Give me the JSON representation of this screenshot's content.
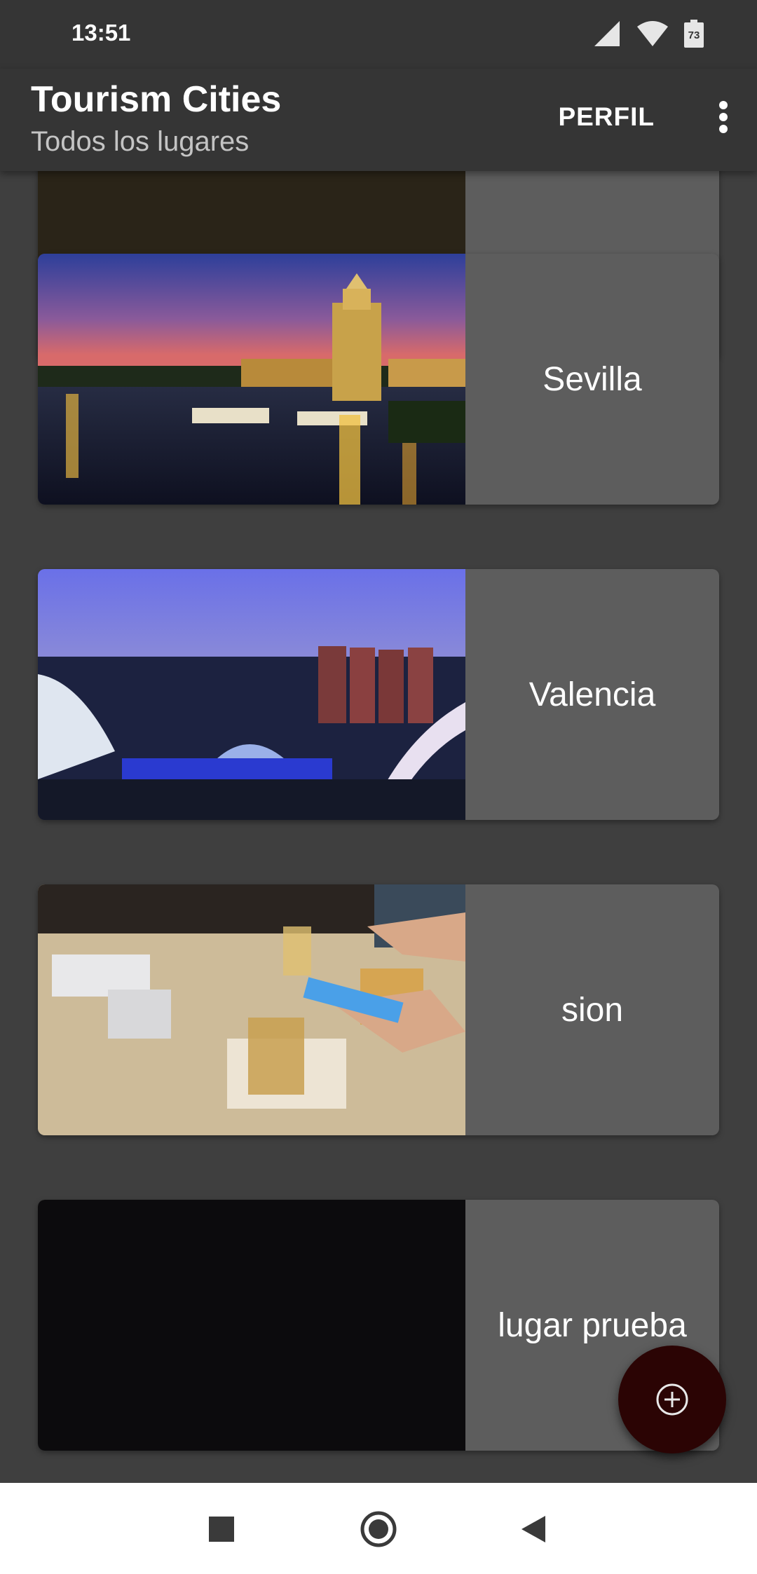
{
  "status_bar": {
    "time": "13:51",
    "battery_level": "73",
    "icons": [
      "signal-icon",
      "wifi-icon",
      "battery-icon"
    ]
  },
  "app_bar": {
    "title": "Tourism Cities",
    "subtitle": "Todos los lugares",
    "profile_label": "PERFIL",
    "overflow_icon": "more-vert-icon"
  },
  "places": [
    {
      "name": "",
      "image": "city-night-photo"
    },
    {
      "name": "Sevilla",
      "image": "sevilla-torre-del-oro-photo"
    },
    {
      "name": "Valencia",
      "image": "valencia-ciudad-artes-photo"
    },
    {
      "name": "sion",
      "image": "table-drinks-photo"
    },
    {
      "name": "lugar prueba",
      "image": "black-placeholder"
    }
  ],
  "fab": {
    "icon": "add-circle-icon"
  },
  "nav_bar": {
    "icons": [
      "recents-square-icon",
      "home-circle-icon",
      "back-triangle-icon"
    ]
  },
  "colors": {
    "background": "#3f3f3f",
    "app_bar": "#353535",
    "card_label_bg": "#5d5d5d",
    "fab": "#2b0404"
  }
}
